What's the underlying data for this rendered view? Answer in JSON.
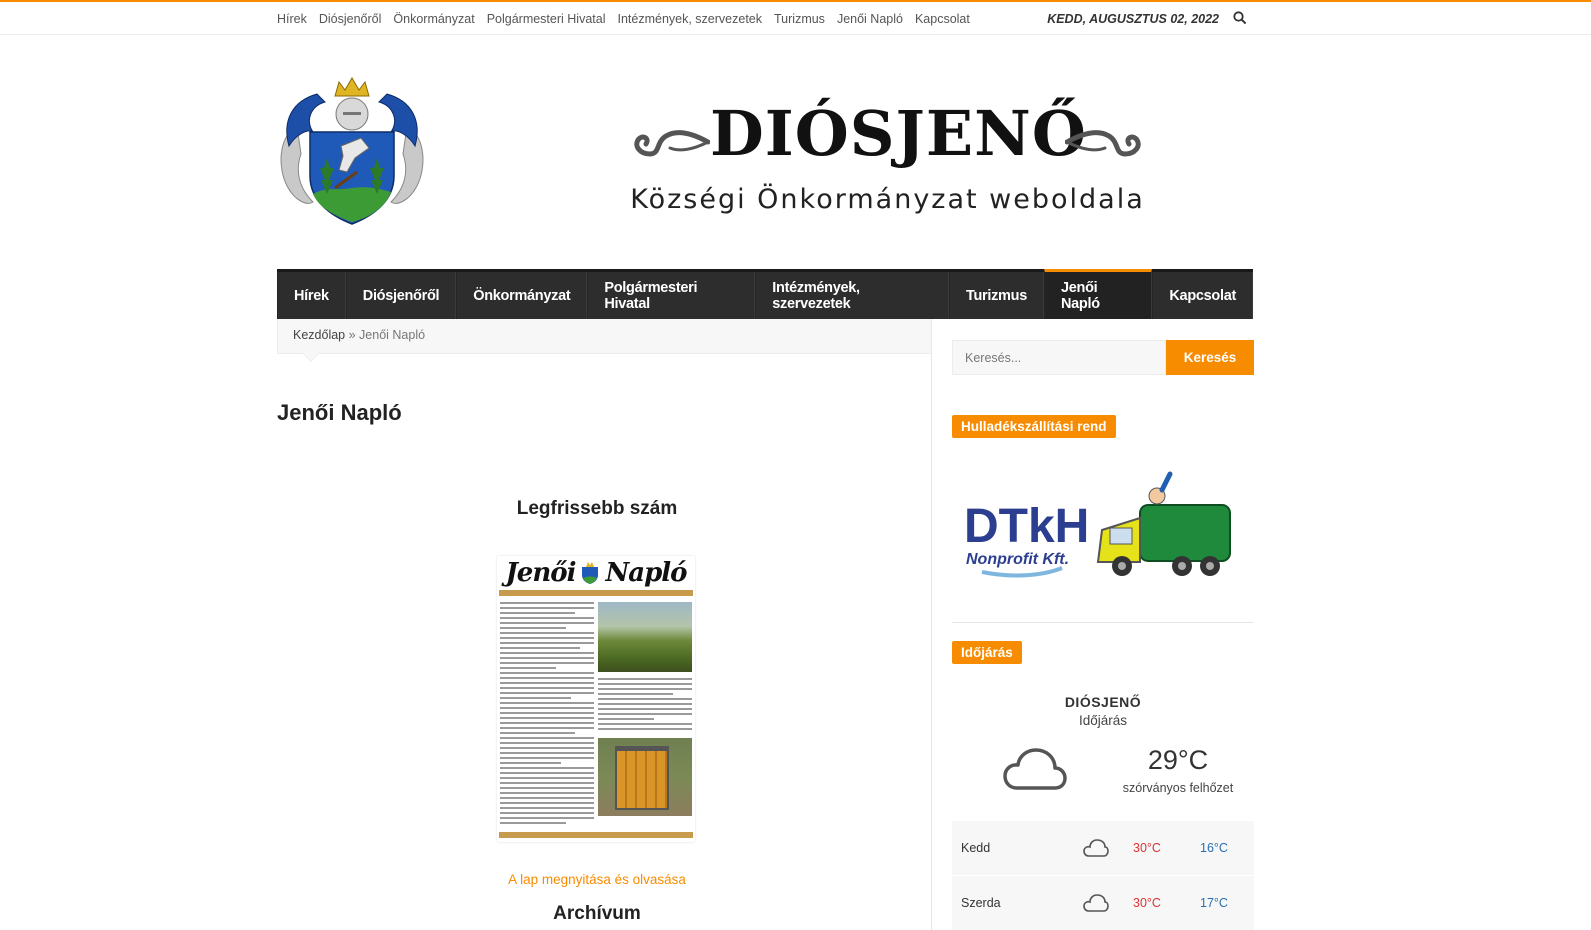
{
  "topbar": {
    "nav": [
      "Hírek",
      "Diósjenőről",
      "Önkormányzat",
      "Polgármesteri Hivatal",
      "Intézmények, szervezetek",
      "Turizmus",
      "Jenői Napló",
      "Kapcsolat"
    ],
    "date": "KEDD, AUGUSZTUS 02, 2022"
  },
  "brand": {
    "title": "DIÓSJENŐ",
    "subtitle": "Községi Önkormányzat weboldala"
  },
  "mainnav": {
    "items": [
      "Hírek",
      "Diósjenőről",
      "Önkormányzat",
      "Polgármesteri Hivatal",
      "Intézmények, szervezetek",
      "Turizmus",
      "Jenői Napló",
      "Kapcsolat"
    ],
    "active": "Jenői Napló"
  },
  "breadcrumb": {
    "home": "Kezdőlap",
    "separator": "»",
    "current": "Jenői Napló"
  },
  "main": {
    "title": "Jenői Napló",
    "latest_heading": "Legfrissebb szám",
    "cover": {
      "masthead_left": "Jenői",
      "masthead_right": "Napló"
    },
    "open_link": "A lap megnyitása és olvasása",
    "archive_heading": "Archívum"
  },
  "sidebar": {
    "search": {
      "placeholder": "Keresés...",
      "button": "Keresés"
    },
    "waste": {
      "title": "Hulladékszállítási rend",
      "logo_text": "DTkH",
      "logo_sub": "Nonprofit Kft."
    },
    "weather": {
      "title": "Időjárás",
      "city": "DIÓSJENŐ",
      "label": "Időjárás",
      "temp": "29°C",
      "desc": "szórványos felhőzet",
      "icon": "cloud-icon",
      "forecast": [
        {
          "day": "Kedd",
          "high": "30°C",
          "low": "16°C"
        },
        {
          "day": "Szerda",
          "high": "30°C",
          "low": "17°C"
        }
      ]
    }
  },
  "colors": {
    "accent": "#f88c00",
    "nav_bg": "#2d2d2d",
    "high": "#dd3333",
    "low": "#2a6fb0"
  }
}
